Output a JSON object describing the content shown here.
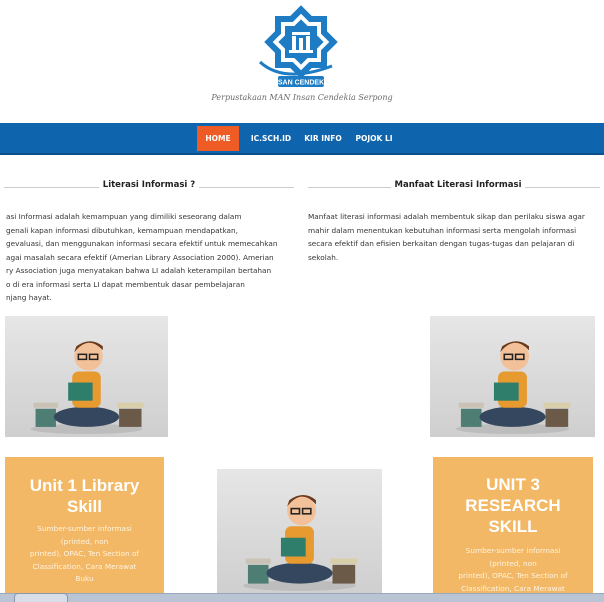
{
  "site": {
    "logo_text": "INSAN CENDEKIA",
    "tagline": "Perpustakaan MAN Insan Cendekia Serpong"
  },
  "nav": {
    "items": [
      {
        "label": "HOME",
        "active": true
      },
      {
        "label": "IC.SCH.ID",
        "active": false
      },
      {
        "label": "KIR INFO",
        "active": false
      },
      {
        "label": "POJOK LI",
        "active": false
      }
    ]
  },
  "sections": {
    "left": {
      "heading": "Literasi Informasi ?",
      "lines": [
        "asi Informasi adalah kemampuan yang dimiliki seseorang dalam",
        "genali kapan informasi dibutuhkan, kemampuan mendapatkan,",
        "gevaluasi, dan menggunakan informasi secara efektif untuk memecahkan",
        "agai masalah secara efektif (Amerian Library Association 2000). Amerian",
        "ry Association juga menyatakan bahwa LI adalah keterampilan bertahan",
        "o di era informasi serta LI dapat membentuk dasar pembelajaran",
        "njang hayat."
      ]
    },
    "right": {
      "heading": "Manfaat Literasi Informasi",
      "lines": [
        "Manfaat literasi informasi adalah membentuk sikap dan perilaku siswa agar",
        "mahir dalam menentukan kebutuhan informasi serta mengolah informasi",
        "secara efektif dan efisien berkaitan dengan tugas-tugas dan pelajaran di",
        "sekolah."
      ]
    }
  },
  "cards": {
    "unit1": {
      "title_lines": [
        "Unit 1 Library",
        "Skill"
      ],
      "desc_lines": [
        "Sumber-sumber informasi",
        "(printed, non",
        "printed), OPAC, Ten Section of",
        "Classification, Cara Merawat",
        "Buku"
      ]
    },
    "unit3": {
      "title_lines": [
        "UNIT 3",
        "RESEARCH",
        "SKILL"
      ],
      "desc_lines": [
        "Sumber-sumber informasi",
        "(printed, non",
        "printed), OPAC, Ten Section of",
        "Classification, Cara Merawat"
      ]
    }
  },
  "colors": {
    "navbar": "#0e64ad",
    "nav_active": "#ef5b25",
    "card": "#f2b866",
    "logo": "#1d7cc4"
  },
  "icons": {
    "logo": "insan-cendekia-logo-icon",
    "illustration": "reading-student-illustration"
  }
}
